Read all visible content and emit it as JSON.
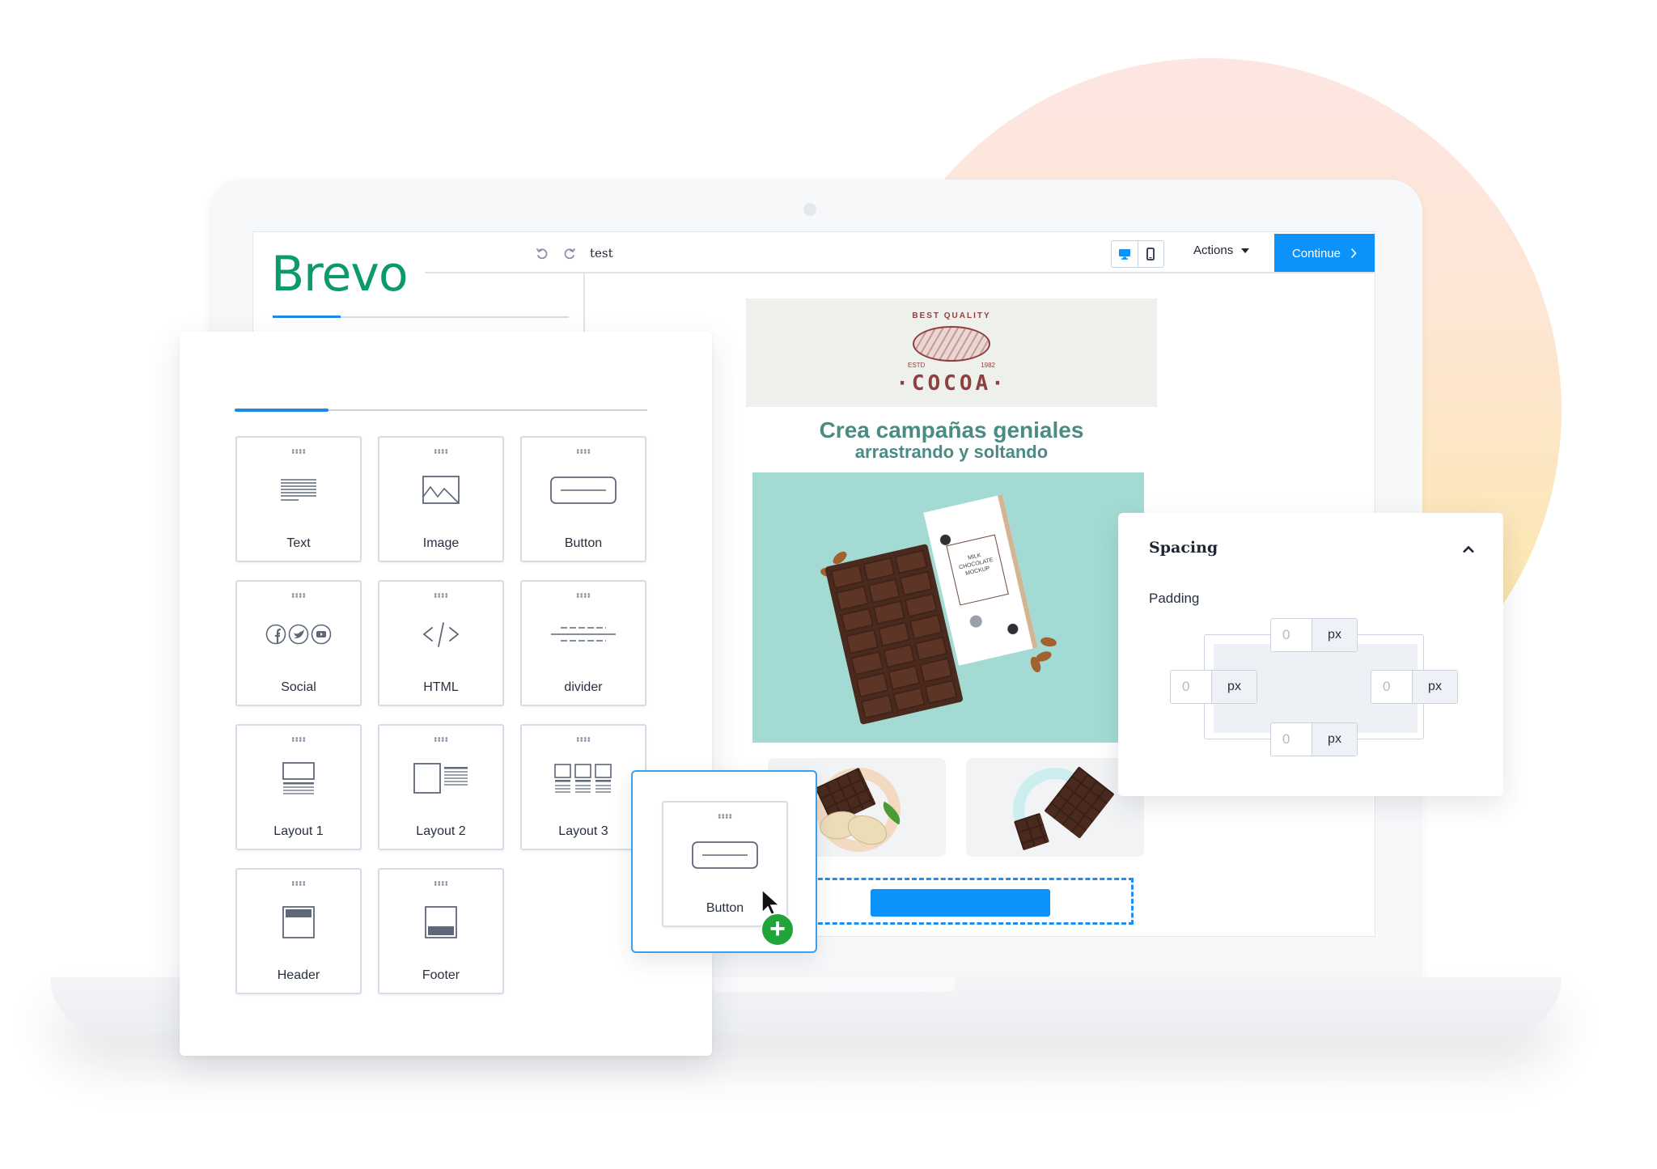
{
  "editor": {
    "brand": "Brevo",
    "document_name": "test",
    "undo_icon": "undo-icon",
    "redo_icon": "redo-icon",
    "device_toggle": [
      {
        "icon": "desktop-icon",
        "active": true
      },
      {
        "icon": "mobile-icon",
        "active": false
      }
    ],
    "actions_label": "Actions",
    "continue_label": "Continue",
    "accent_color": "#0b92fb",
    "brand_color": "#0b996e"
  },
  "email": {
    "header_logo": {
      "top_text": "BEST QUALITY",
      "estd": "ESTD",
      "year": "1982",
      "name": "·COCOA·"
    },
    "title_line1": "Crea campañas geniales",
    "title_line2": "arrastrando y soltando",
    "hero_image": {
      "label_line1": "MILK",
      "label_line2": "CHOCOLATE",
      "label_line3": "MOCKUP"
    },
    "thumbnails": [
      "chocolate-pistachio-image",
      "broken-chocolate-bar-image"
    ],
    "title_color": "#4a8c84"
  },
  "blocks_panel": {
    "blocks": [
      {
        "label": "Text",
        "icon": "text-icon"
      },
      {
        "label": "Image",
        "icon": "image-icon"
      },
      {
        "label": "Button",
        "icon": "button-icon"
      },
      {
        "label": "Social",
        "icon": "social-icon"
      },
      {
        "label": "HTML",
        "icon": "code-icon"
      },
      {
        "label": "divider",
        "icon": "divider-icon"
      },
      {
        "label": "Layout 1",
        "icon": "layout-1-icon"
      },
      {
        "label": "Layout 2",
        "icon": "layout-2-icon"
      },
      {
        "label": "Layout 3",
        "icon": "layout-3-icon"
      },
      {
        "label": "Header",
        "icon": "header-icon"
      },
      {
        "label": "Footer",
        "icon": "footer-icon"
      }
    ]
  },
  "dragging": {
    "label": "Button",
    "icon": "button-icon",
    "badge": "+"
  },
  "spacing": {
    "title": "Spacing",
    "padding_label": "Padding",
    "unit": "px",
    "top": "0",
    "right": "0",
    "bottom": "0",
    "left": "0"
  }
}
